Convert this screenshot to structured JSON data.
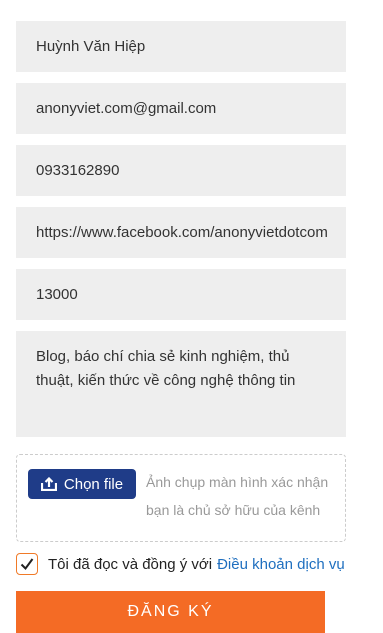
{
  "form": {
    "fields": [
      {
        "value": "Huỳnh Văn Hiệp"
      },
      {
        "value": "anonyviet.com@gmail.com"
      },
      {
        "value": "0933162890"
      },
      {
        "value": "https://www.facebook.com/anonyvietdotcom"
      },
      {
        "value": "13000"
      }
    ],
    "description": {
      "value": "Blog, báo chí chia sẻ kinh nghiệm, thủ thuật, kiến thức về công nghệ thông tin"
    },
    "upload": {
      "button_label": "Chọn file",
      "button_icon": "upload-icon",
      "hint": "Ảnh chụp màn hình xác nhận bạn là chủ sở hữu của kênh"
    },
    "agreement": {
      "checked": true,
      "check_icon": "checkmark-icon",
      "text": "Tôi đã đọc và đồng ý với",
      "link_text": "Điều khoản dịch vụ"
    },
    "submit_label": "ĐĂNG KÝ"
  },
  "colors": {
    "field_bg": "#eeeeee",
    "button_blue": "#1f3c88",
    "accent_orange": "#f46b25",
    "link_blue": "#1f6fbf"
  }
}
